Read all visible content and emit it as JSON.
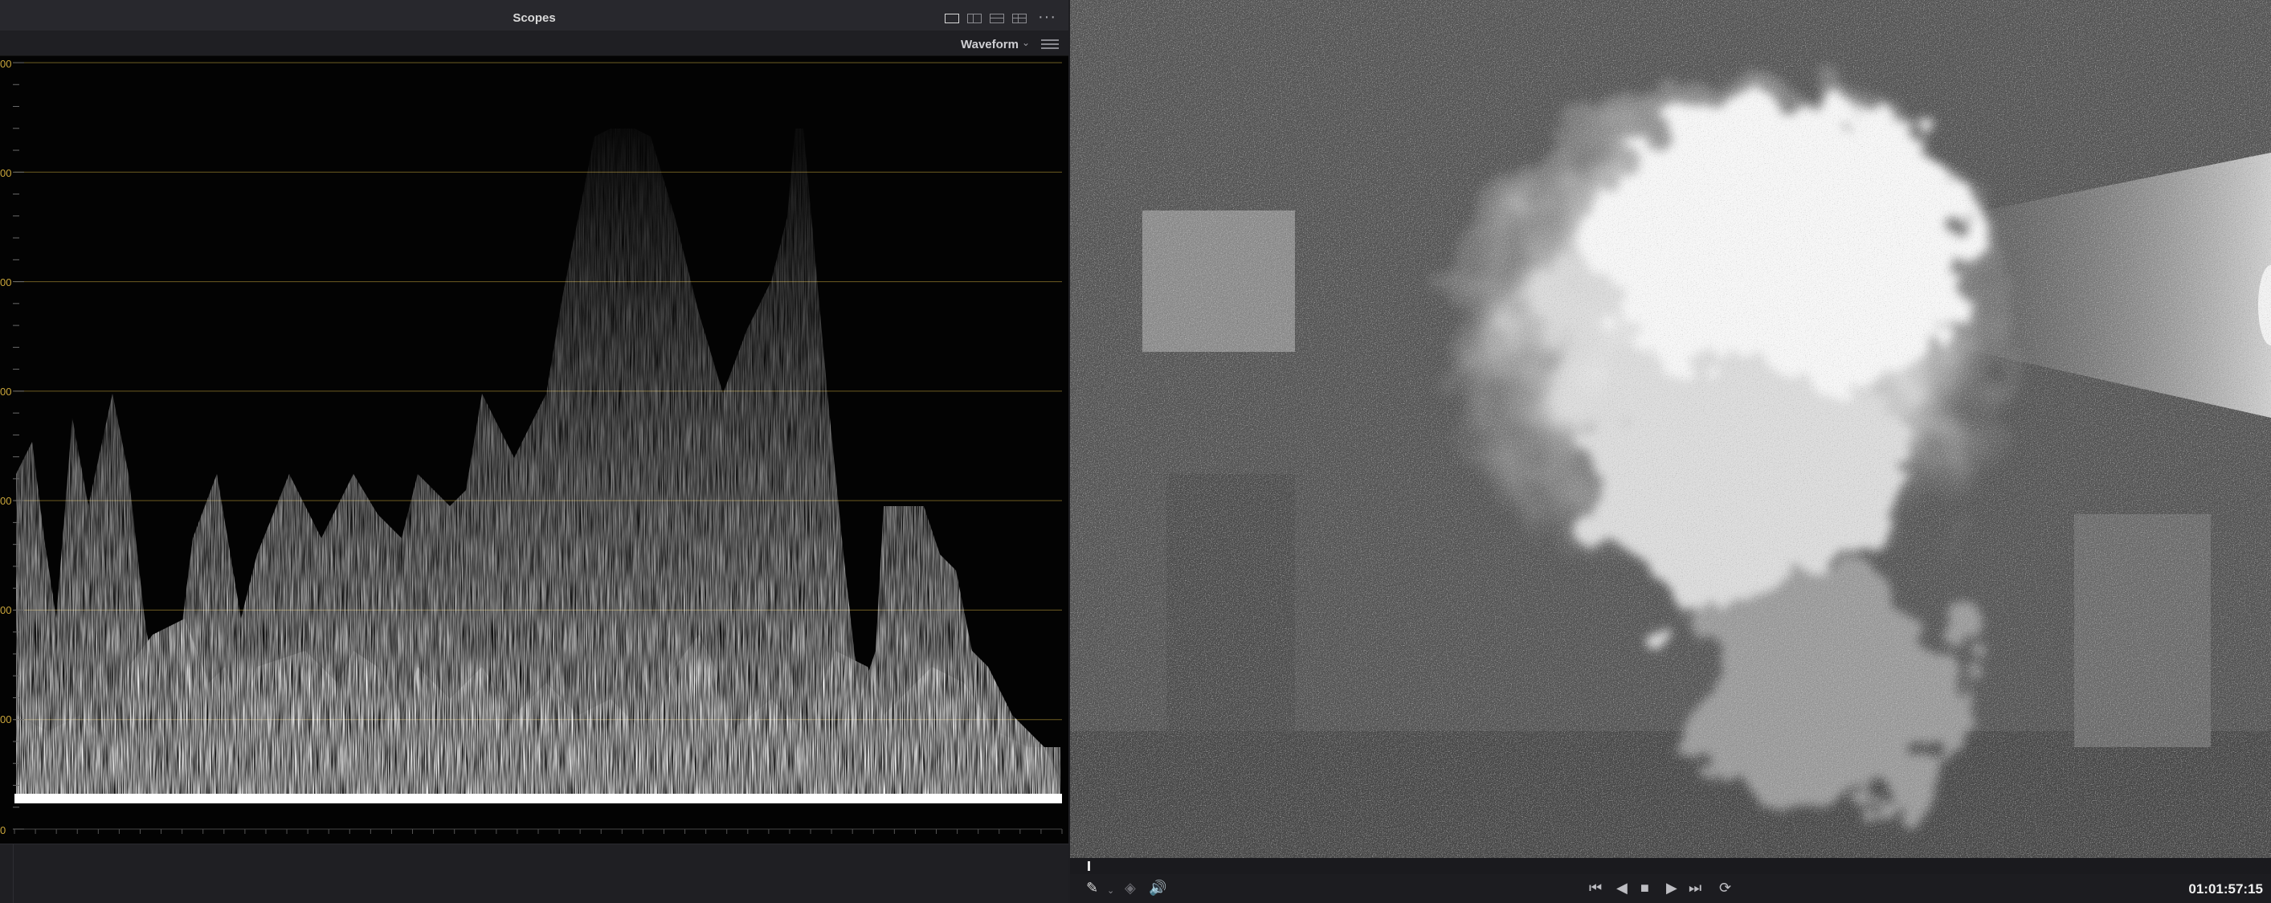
{
  "scopes": {
    "title": "Scopes",
    "scope_type": "Waveform",
    "scale_labels": [
      "00",
      "00",
      "00",
      "00",
      "00",
      "00",
      "00",
      "0"
    ]
  },
  "icons": {
    "layout_single": "single-layout-icon",
    "layout_dual": "dual-layout-icon",
    "layout_triple": "triple-layout-icon",
    "layout_quad": "quad-layout-icon",
    "more": "more-options-icon",
    "settings": "scope-settings-icon",
    "picker": "color-picker-icon",
    "layers": "layers-icon",
    "volume": "volume-icon",
    "skip_start": "skip-to-start-icon",
    "step_back": "play-reverse-icon",
    "stop": "stop-icon",
    "play": "play-icon",
    "skip_end": "skip-to-end-icon",
    "loop": "loop-icon"
  },
  "glyphs": {
    "more": "···",
    "chevron": "⌄",
    "picker": "✎",
    "picker_chevron": "⌄",
    "layers": "◈",
    "volume": "🔊",
    "skip_start": "⏮",
    "step_back": "◀",
    "stop": "■",
    "play": "▶",
    "skip_end": "⏭",
    "loop": "⟳"
  },
  "viewer": {
    "timecode": "01:01:57:15"
  },
  "colors": {
    "graticule": "#6e5c23",
    "scale_text": "#c9a53a",
    "panel_bg": "#1c1c20"
  }
}
